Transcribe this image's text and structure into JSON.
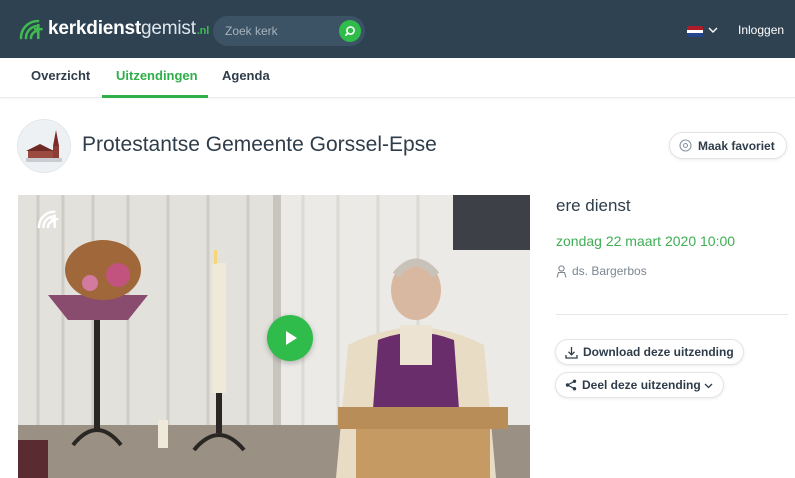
{
  "header": {
    "logo": {
      "bold": "kerkdienst",
      "light": "gemist",
      "tld": ".nl"
    },
    "search": {
      "placeholder": "Zoek kerk",
      "value": ""
    },
    "language": {
      "flag_colors": [
        "#ae1c28",
        "#ffffff",
        "#21468b"
      ]
    },
    "login_label": "Inloggen"
  },
  "nav": {
    "tabs": [
      {
        "label": "Overzicht",
        "active": false
      },
      {
        "label": "Uitzendingen",
        "active": true
      },
      {
        "label": "Agenda",
        "active": false
      }
    ]
  },
  "church": {
    "name": "Protestantse Gemeente Gorssel-Epse",
    "favorite_label": "Maak favoriet"
  },
  "broadcast": {
    "title": "ere dienst",
    "date": "zondag 22 maart 2020 10:00",
    "preacher": "ds. Bargerbos",
    "download_label": "Download deze uitzending",
    "share_label": "Deel deze uitzending"
  },
  "colors": {
    "topbar": "#2e4252",
    "accent_green": "#2fbc4a",
    "text_dark": "#2f3d4a"
  }
}
